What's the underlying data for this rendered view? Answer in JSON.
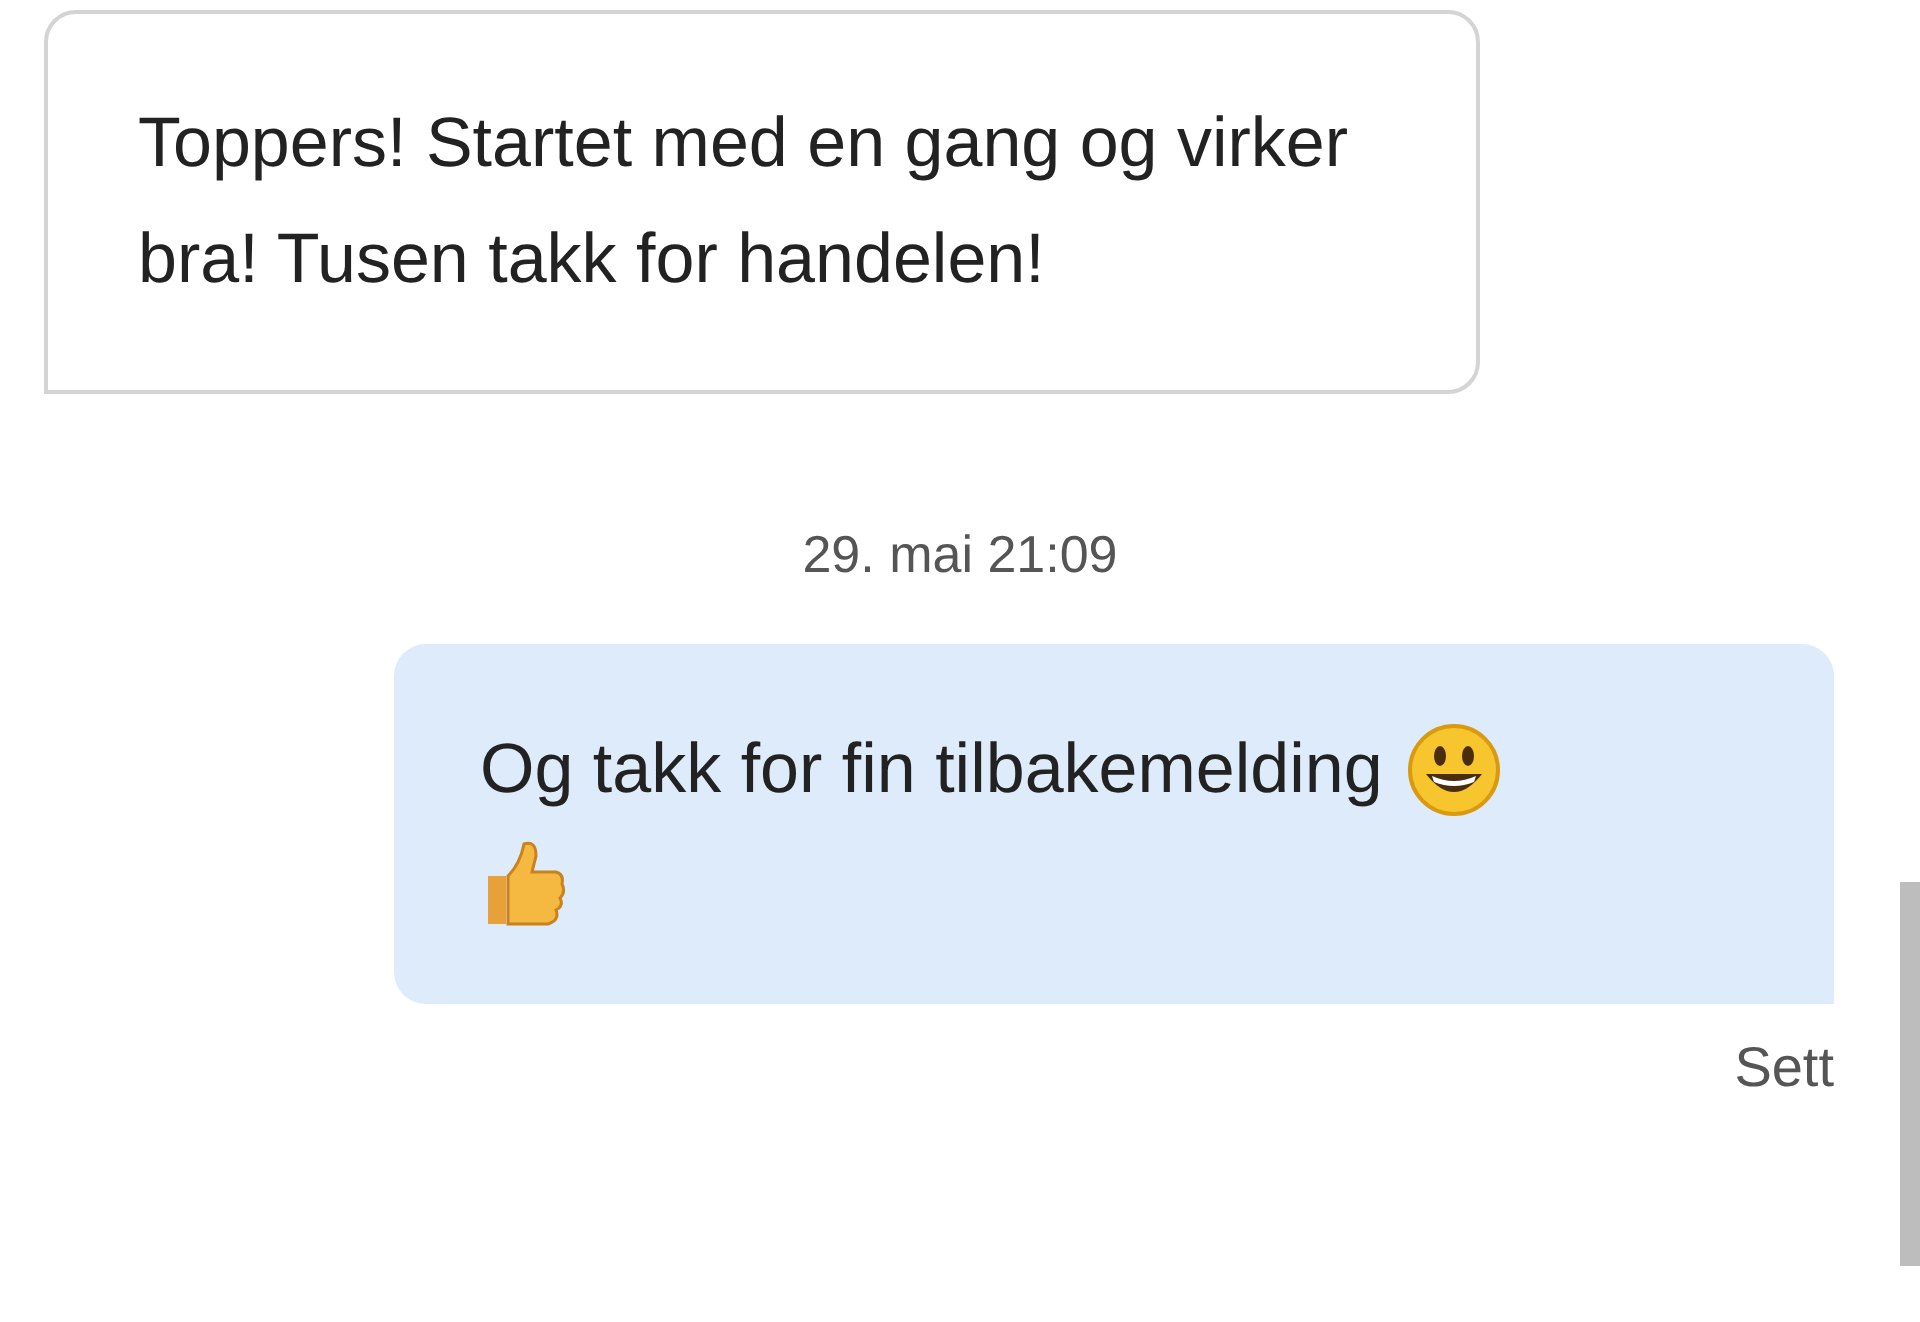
{
  "messages": [
    {
      "kind": "received",
      "text": "Toppers! Startet med en gang og virker bra! Tusen takk for handelen!"
    },
    {
      "kind": "timestamp",
      "text": "29. mai 21:09"
    },
    {
      "kind": "sent",
      "text": "Og takk for fin tilbakemelding",
      "status": "Sett"
    }
  ]
}
